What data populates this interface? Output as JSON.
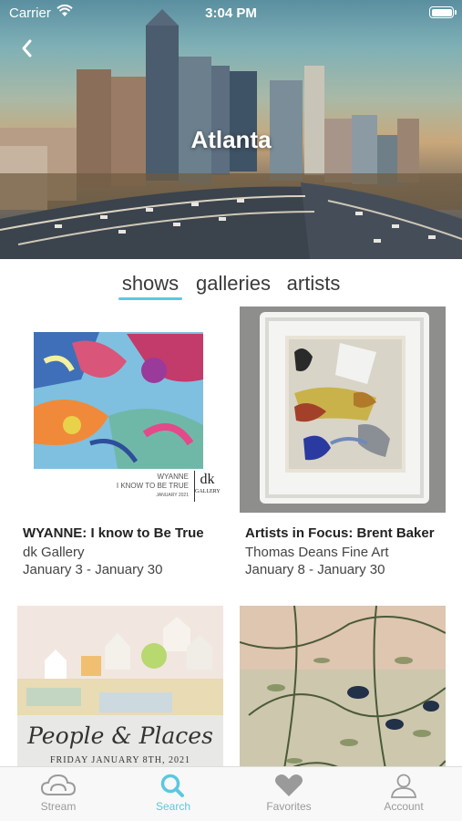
{
  "status_bar": {
    "carrier": "Carrier",
    "time": "3:04 PM"
  },
  "header": {
    "city": "Atlanta",
    "back_icon": "chevron-left-icon"
  },
  "tabs": [
    {
      "label": "shows",
      "active": true
    },
    {
      "label": "galleries",
      "active": false
    },
    {
      "label": "artists",
      "active": false
    }
  ],
  "shows": [
    {
      "title": "WYANNE: I know to Be True",
      "gallery": "dk Gallery",
      "dates": "January 3 - January 30",
      "art_caption_line1": "WYANNE",
      "art_caption_line2": "I KNOW TO BE TRUE",
      "art_caption_line3": "JANUARY 2021",
      "art_logo": "dk",
      "art_logo_sub": "GALLERY"
    },
    {
      "title": "Artists in Focus: Brent Baker",
      "gallery": "Thomas Deans Fine Art",
      "dates": "January 8 - January 30"
    },
    {
      "title": "",
      "gallery": "",
      "dates": "",
      "art_script": "People & Places",
      "art_caption": "FRIDAY JANUARY 8TH, 2021"
    },
    {
      "title": "",
      "gallery": "",
      "dates": ""
    }
  ],
  "tabbar": [
    {
      "label": "Stream",
      "icon": "cloud-icon",
      "active": false
    },
    {
      "label": "Search",
      "icon": "search-icon",
      "active": true
    },
    {
      "label": "Favorites",
      "icon": "heart-icon",
      "active": false
    },
    {
      "label": "Account",
      "icon": "person-icon",
      "active": false
    }
  ],
  "colors": {
    "accent": "#5bc8e0",
    "inactive": "#9a9a9a"
  }
}
